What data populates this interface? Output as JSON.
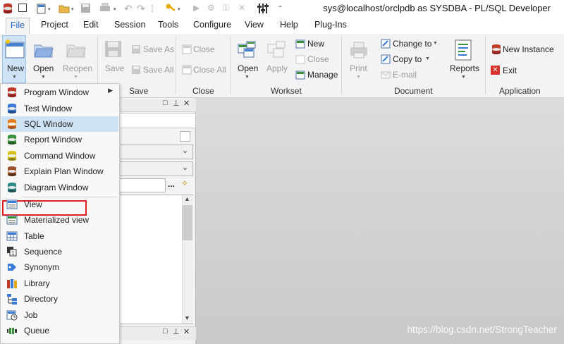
{
  "window": {
    "title": "sys@localhost/orclpdb as SYSDBA - PL/SQL Developer"
  },
  "menu_tabs": [
    "File",
    "Project",
    "Edit",
    "Session",
    "Tools",
    "Configure",
    "View",
    "Help",
    "Plug-Ins"
  ],
  "ribbon": {
    "file_group": {
      "new": "New",
      "open": "Open",
      "reopen": "Reopen"
    },
    "save_group": {
      "save": "Save",
      "save_as": "Save As",
      "save_all": "Save All",
      "label": "Save"
    },
    "close_group": {
      "close": "Close",
      "close_all": "Close All",
      "label": "Close"
    },
    "workset_group": {
      "open": "Open",
      "apply": "Apply",
      "new": "New",
      "close": "Close",
      "manage": "Manage",
      "label": "Workset"
    },
    "document_group": {
      "print": "Print",
      "change_to": "Change to",
      "copy_to": "Copy to",
      "email": "E-mail",
      "reports": "Reports",
      "label": "Document"
    },
    "application_group": {
      "new_instance": "New Instance",
      "exit": "Exit",
      "label": "Application"
    }
  },
  "new_menu": {
    "items": [
      {
        "label": "Program Window",
        "icon": "program-window-icon",
        "submenu": true
      },
      {
        "label": "Test Window",
        "icon": "test-window-icon"
      },
      {
        "label": "SQL Window",
        "icon": "sql-window-icon",
        "selected": true
      },
      {
        "label": "Report Window",
        "icon": "report-window-icon"
      },
      {
        "label": "Command Window",
        "icon": "command-window-icon"
      },
      {
        "label": "Explain Plan Window",
        "icon": "explain-plan-icon"
      },
      {
        "label": "Diagram Window",
        "icon": "diagram-window-icon"
      },
      {
        "label": "View",
        "icon": "view-icon"
      },
      {
        "label": "Materialized view",
        "icon": "materialized-view-icon"
      },
      {
        "label": "Table",
        "icon": "table-icon"
      },
      {
        "label": "Sequence",
        "icon": "sequence-icon"
      },
      {
        "label": "Synonym",
        "icon": "synonym-icon"
      },
      {
        "label": "Library",
        "icon": "library-icon"
      },
      {
        "label": "Directory",
        "icon": "directory-icon"
      },
      {
        "label": "Job",
        "icon": "job-icon"
      },
      {
        "label": "Queue",
        "icon": "queue-icon"
      }
    ],
    "highlight_color": "#e02020"
  },
  "side_panel": {
    "more_button": "..."
  },
  "watermark": "https://blog.csdn.net/StrongTeacher",
  "colors": {
    "accent": "#1f5fbf",
    "selection": "#cfe3f7",
    "workspace": "#d0d0d0"
  }
}
